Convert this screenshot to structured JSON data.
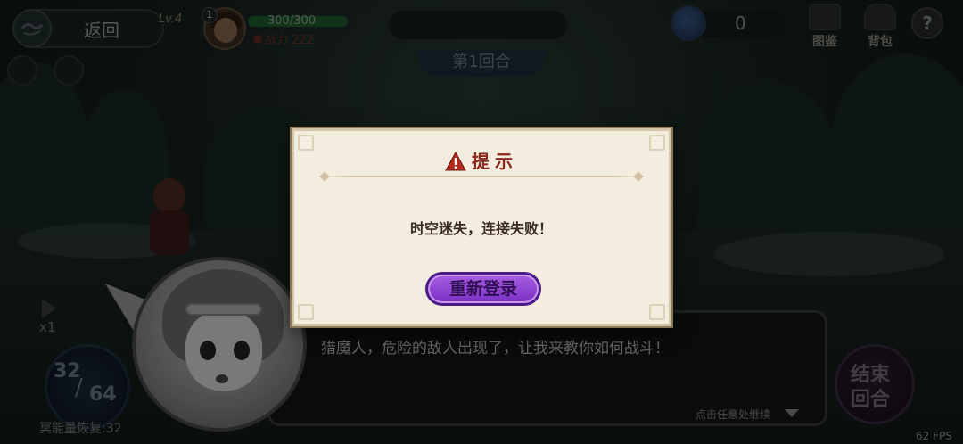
{
  "top_bar": {
    "back_label": "返回",
    "level_badge": "Lv.4",
    "avatar_level": "1",
    "hp_text": "300/300",
    "hp_fraction": 1.0,
    "power_text": "战力 222",
    "gem_count": "0",
    "codex_label": "图鉴",
    "bag_label": "背包",
    "help_label": "?"
  },
  "battle": {
    "round_label": "第1回合",
    "speed_label": "x1",
    "energy_current": "32",
    "energy_max": "64",
    "energy_regen": "冥能量恢复:32",
    "end_turn_line1": "结束",
    "end_turn_line2": "回合",
    "fps": "62 FPS"
  },
  "dialog": {
    "text": "猎魔人，危险的敌人出现了，让我来教你如何战斗！",
    "hint": "点击任意处继续"
  },
  "modal": {
    "title": "提示",
    "message": "时空迷失，连接失败！",
    "button_label": "重新登录",
    "title_color": "#8a2a1e",
    "button_color": "#8b3fd6"
  }
}
